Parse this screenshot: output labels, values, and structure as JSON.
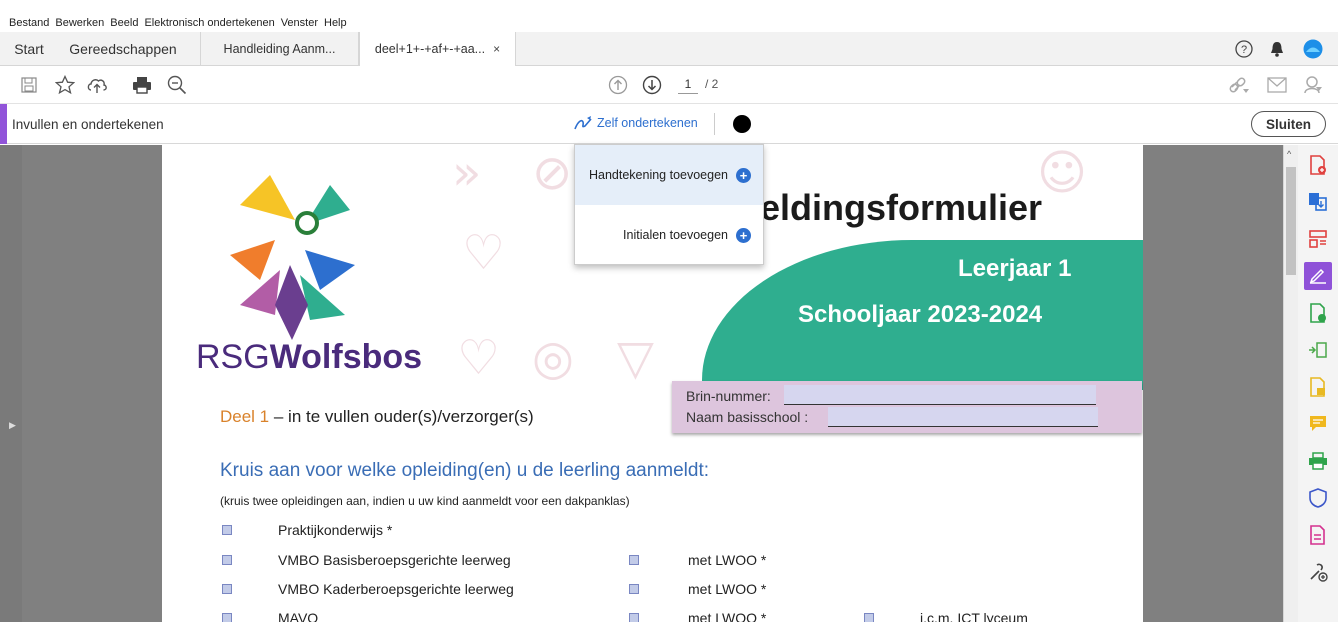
{
  "menu": [
    "Bestand",
    "Bewerken",
    "Beeld",
    "Elektronisch ondertekenen",
    "Venster",
    "Help"
  ],
  "tabs": {
    "start": "Start",
    "tools": "Gereedschappen",
    "tab1": "Handleiding Aanm...",
    "tab2": "deel+1+-+af+-+aa...",
    "close": "×"
  },
  "toolbar": {
    "page_current": "1",
    "page_total": "/ 2"
  },
  "fillsign": {
    "title": "Invullen en ondertekenen",
    "sign_label": "Zelf ondertekenen",
    "close_label": "Sluiten"
  },
  "dropdown": {
    "signature": "Handtekening toevoegen",
    "initials": "Initialen toevoegen",
    "plus": "+"
  },
  "document": {
    "title_partial": "eldingsformulier",
    "grade": "Leerjaar 1",
    "school_year": "Schooljaar 2023-2024",
    "logo_text_a": "RSG",
    "logo_text_b": "Wolfsbos",
    "brin_label": "Brin-nummer:",
    "school_label": "Naam basisschool :",
    "part_prefix": "Deel 1",
    "part_rest": " – in te vullen ouder(s)/verzorger(s)",
    "heading": "Kruis aan voor welke opleiding(en) u de leerling aanmeldt:",
    "note": "(kruis twee opleidingen aan, indien u uw kind aanmeldt voor een dakpanklas)",
    "options": [
      {
        "label": "Praktijkonderwijs  *",
        "lwoo": "",
        "extra": ""
      },
      {
        "label": "VMBO Basisberoepsgerichte leerweg",
        "lwoo": "met LWOO *",
        "extra": ""
      },
      {
        "label": "VMBO Kaderberoepsgerichte leerweg",
        "lwoo": "met LWOO *",
        "extra": ""
      },
      {
        "label": "MAVO",
        "lwoo": "met LWOO *",
        "extra": "i.c.m. ICT lyceum"
      }
    ]
  },
  "colors": {
    "accent": "#9154d9",
    "green": "#2fae8f",
    "blue_link": "#2d6fcf",
    "heading_blue": "#3a6db5",
    "orange": "#d9822b"
  }
}
